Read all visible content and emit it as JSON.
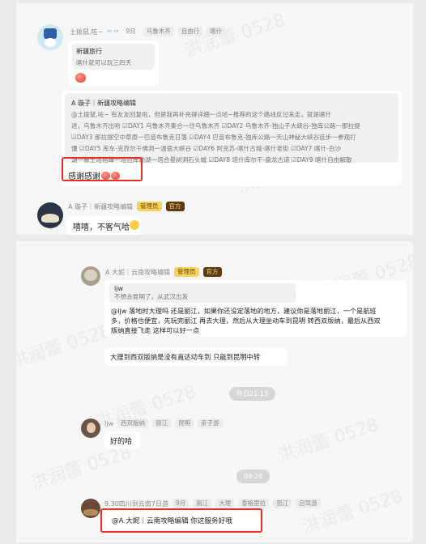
{
  "panel1": {
    "watermark": "洪润蕾 0528",
    "msg1": {
      "name": "土拨鼠,咗~",
      "tags": [
        "9月",
        "乌鲁木齐",
        "自由行",
        "喀什"
      ],
      "quote_title": "新疆旅行",
      "quote_text": "喀什就可以玩三四天"
    },
    "msg2": {
      "quote_header": "A 璇子｜新疆攻略编辑",
      "quote_lines": [
        "@土拨鼠,咗~ 有友友回复啦，但是我再补充得详细一点哈~推荐的这个路线反过来走，就是喀什",
        "进，乌鲁木齐出哈 ☑DAY1 乌鲁木齐集合一住乌鲁木齐 ☑DAY2 乌鲁木齐-独山子大峡谷-独库公路一那拉提",
        "☑DAY3 那拉提空中草原一巴音布鲁克日落 ☑DAY4 巴音布鲁克-独库公路一天山神秘大峡谷徒步一参观打",
        "馕 ☑DAY5 库车-克孜尔千佛洞一温宿大峡谷 ☑DAY6 阿克苏-喀什古城-喀什老街 ☑DAY7 喀什-白沙",
        "湖一慕士塔格峰一塔拉库勒湖一塔合曼树洞石头城 ☑DAY8 塔什库尔干-盘龙古道 ☑DAY9 喀什自由解散"
      ],
      "reply": "感谢感谢"
    },
    "msg3": {
      "name": "A 璇子｜新疆攻略编辑",
      "badge_admin": "管理员",
      "badge_official": "官方",
      "text": "嘻嘻，不客气哈"
    }
  },
  "panel2": {
    "watermark": "洪润蕾 0528",
    "msg1": {
      "name": "A 大妮｜云南攻略编辑",
      "badge_admin": "管理员",
      "badge_official": "官方",
      "quote_user": "ljw",
      "quote_text": "不想去昆明了，从武汉出发",
      "reply_lines": [
        "@ljw  落地时大理吗 还是丽江，如果你还没定落地的地方，建议你是落地丽江，一个是航班",
        "多，价格也便宜，先玩完丽江 再去大理，然后从大理坐动车到昆明 转西双版纳，最后从西双",
        "版纳直接飞走  这样可以好一点"
      ],
      "second": "大理到西双版纳是没有直达动车到 只能到昆明中转"
    },
    "time1": "昨日21:13",
    "msg2": {
      "name": "ljw",
      "tags": [
        "西双版纳",
        "丽江",
        "昆明",
        "亲子游"
      ],
      "text": "好的哈"
    },
    "time2": "09:28",
    "msg3": {
      "name": "9.30四川到云南7日游",
      "tags": [
        "9月",
        "丽江",
        "大理",
        "香格里拉",
        "怒江",
        "自驾游"
      ],
      "text": "@A 大妮｜云南攻略编辑 你这服务好哦"
    }
  }
}
